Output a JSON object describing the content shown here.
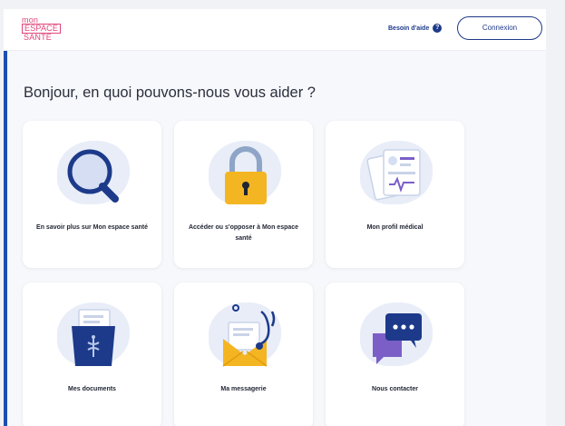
{
  "header": {
    "logo_line1": "mon",
    "logo_line2": "ESPACE",
    "logo_line3": "SANTÉ",
    "help_label": "Besoin d'aide",
    "help_icon": "question-icon",
    "connect_label": "Connexion"
  },
  "main": {
    "title": "Bonjour, en quoi pouvons-nous vous aider ?"
  },
  "cards": [
    {
      "label": "En savoir plus sur Mon espace santé",
      "icon": "magnifier-icon"
    },
    {
      "label": "Accéder ou s'opposer à Mon espace santé",
      "icon": "padlock-icon"
    },
    {
      "label": "Mon profil médical",
      "icon": "medical-profile-icon"
    },
    {
      "label": "Mes documents",
      "icon": "documents-folder-icon"
    },
    {
      "label": "Ma messagerie",
      "icon": "mail-stethoscope-icon"
    },
    {
      "label": "Nous contacter",
      "icon": "chat-bubbles-icon"
    }
  ],
  "colors": {
    "brand_pink": "#e0457b",
    "brand_blue": "#1d3a8a",
    "accent": "#1d4fb3"
  }
}
